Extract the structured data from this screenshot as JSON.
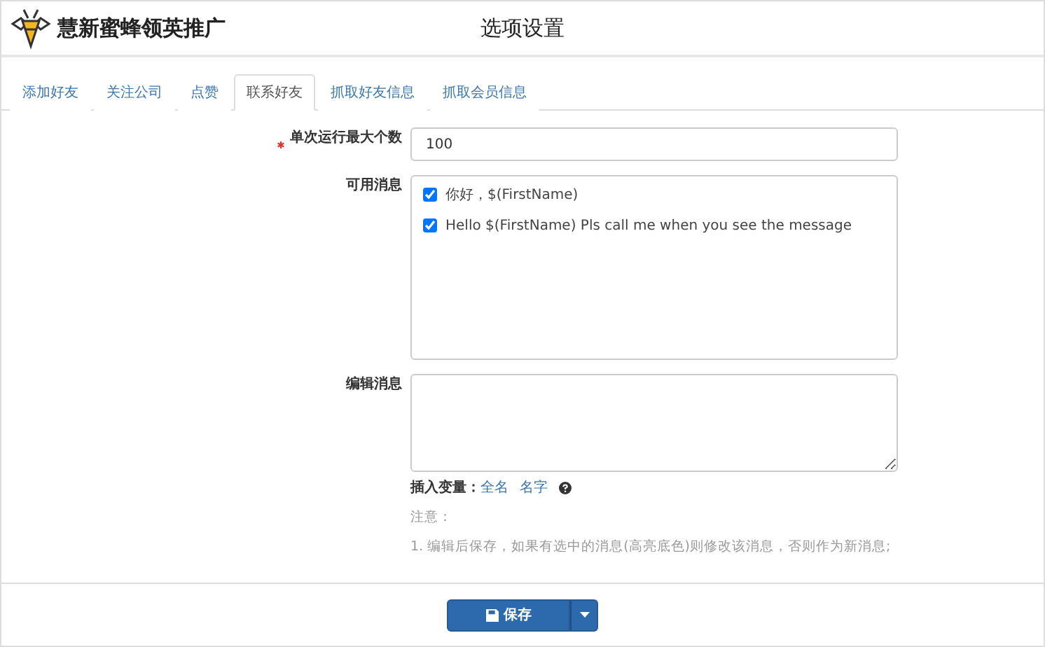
{
  "header": {
    "brand": "慧新蜜蜂领英推广",
    "title": "选项设置"
  },
  "tabs": [
    {
      "label": "添加好友",
      "selected": false
    },
    {
      "label": "关注公司",
      "selected": false
    },
    {
      "label": "点赞",
      "selected": false
    },
    {
      "label": "联系好友",
      "selected": true
    },
    {
      "label": "抓取好友信息",
      "selected": false
    },
    {
      "label": "抓取会员信息",
      "selected": false
    }
  ],
  "form": {
    "max_runs": {
      "label": "单次运行最大个数",
      "required": true,
      "value": "100"
    },
    "messages": {
      "label": "可用消息",
      "items": [
        {
          "text": "你好，$(FirstName)",
          "checked": true
        },
        {
          "text": "Hello $(FirstName) Pls call me when you see the message",
          "checked": true
        }
      ]
    },
    "edit": {
      "label": "编辑消息"
    },
    "insert_variable": {
      "label": "插入变量：",
      "links": [
        "全名",
        "名字"
      ]
    },
    "note_title": "注意：",
    "note": "1. 编辑后保存，如果有选中的消息(高亮底色)则修改该消息，否则作为新消息;"
  },
  "save_button": "保存"
}
